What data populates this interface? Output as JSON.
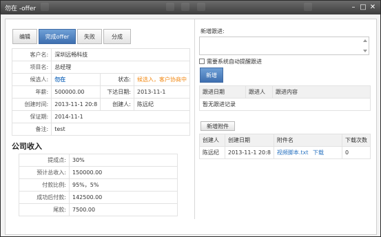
{
  "window": {
    "title": "勿在 -offer"
  },
  "tabs": [
    {
      "label": "编辑"
    },
    {
      "label": "完成offer"
    },
    {
      "label": "失败"
    },
    {
      "label": "分成"
    }
  ],
  "info": {
    "customer_label": "客户名:",
    "customer": "深圳远畅科技",
    "project_label": "项目名:",
    "project": "总经理",
    "candidate_label": "候选人:",
    "candidate": "勿在",
    "status_label": "状态:",
    "status": "候选入，客户协商中",
    "salary_label": "年薪:",
    "salary": "500000.00",
    "order_date_label": "下达日期:",
    "order_date": "2013-11-1",
    "created_label": "创建时间:",
    "created": "2013-11-1 20:8",
    "creator_label": "创建人:",
    "creator": "陈远纪",
    "warranty_label": "保证期:",
    "warranty": "2014-11-1",
    "note_label": "备注:",
    "note": "test"
  },
  "income": {
    "title": "公司收入",
    "rows": [
      {
        "label": "提成点:",
        "value": "30%"
      },
      {
        "label": "预计总收入:",
        "value": "150000.00"
      },
      {
        "label": "付款比例:",
        "value": "95%，5%"
      },
      {
        "label": "成功后付款:",
        "value": "142500.00"
      },
      {
        "label": "尾款:",
        "value": "7500.00"
      }
    ]
  },
  "followup": {
    "label": "新增跟进:",
    "auto_remind": "需要系统自动提醒跟进",
    "add_button": "新增",
    "headers": [
      "跟进日期",
      "跟进人",
      "跟进内容"
    ],
    "empty": "暂无跟进记录"
  },
  "attachments": {
    "add_button": "新增附件",
    "headers": [
      "创建人",
      "创建日期",
      "附件名",
      "下载次数"
    ],
    "rows": [
      {
        "creator": "陈远纪",
        "date": "2013-11-1 20:8",
        "file": "视频脚本.txt",
        "download": "下载",
        "count": "0"
      }
    ]
  }
}
